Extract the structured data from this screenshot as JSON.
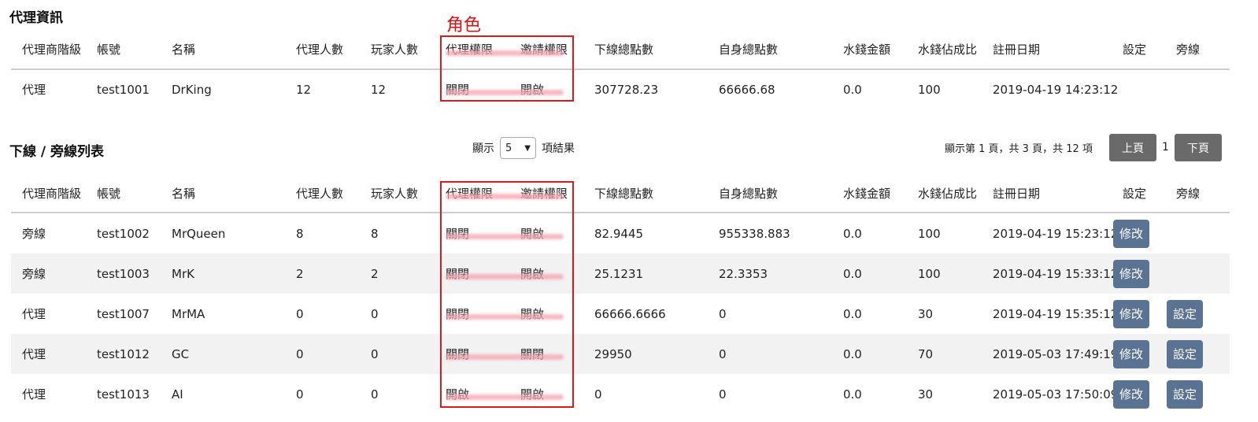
{
  "agent_section": {
    "title": "代理資訊",
    "headers": [
      "代理商階級",
      "帳號",
      "名稱",
      "代理人數",
      "玩家人數",
      "代理權限",
      "邀請權限",
      "下線總點數",
      "自身總點數",
      "水錢金額",
      "水錢佔成比",
      "註冊日期",
      "設定",
      "旁線"
    ],
    "row": {
      "level": "代理",
      "account": "test1001",
      "name": "DrKing",
      "agents": "12",
      "players": "12",
      "agent_perm": "關閉",
      "invite_perm": "開啟",
      "downline_points": "307728.23",
      "self_points": "66666.68",
      "water_amount": "0.0",
      "water_ratio": "100",
      "reg_date": "2019-04-19 14:23:12"
    }
  },
  "annotation": {
    "role_label": "角色"
  },
  "list_section": {
    "title": "下線 / 旁線列表",
    "show_label": "顯示",
    "page_size": "5",
    "results_label": "項結果",
    "page_info": "顯示第 1 頁，共 3 頁，共 12 項",
    "prev_label": "上頁",
    "current_page": "1",
    "next_label": "下頁",
    "headers": [
      "代理商階級",
      "帳號",
      "名稱",
      "代理人數",
      "玩家人數",
      "代理權限",
      "邀請權限",
      "下線總點數",
      "自身總點數",
      "水錢金額",
      "水錢佔成比",
      "註冊日期",
      "設定",
      "旁線"
    ],
    "edit_label": "修改",
    "setting_label": "設定",
    "rows": [
      {
        "level": "旁線",
        "account": "test1002",
        "name": "MrQueen",
        "agents": "8",
        "players": "8",
        "agent_perm": "關閉",
        "invite_perm": "開啟",
        "downline_points": "82.9445",
        "self_points": "955338.883",
        "water_amount": "0.0",
        "water_ratio": "100",
        "reg_date": "2019-04-19 15:23:12",
        "has_setting": false
      },
      {
        "level": "旁線",
        "account": "test1003",
        "name": "MrK",
        "agents": "2",
        "players": "2",
        "agent_perm": "關閉",
        "invite_perm": "開啟",
        "downline_points": "25.1231",
        "self_points": "22.3353",
        "water_amount": "0.0",
        "water_ratio": "100",
        "reg_date": "2019-04-19 15:33:12",
        "has_setting": false
      },
      {
        "level": "代理",
        "account": "test1007",
        "name": "MrMA",
        "agents": "0",
        "players": "0",
        "agent_perm": "關閉",
        "invite_perm": "開啟",
        "downline_points": "66666.6666",
        "self_points": "0",
        "water_amount": "0.0",
        "water_ratio": "30",
        "reg_date": "2019-04-19 15:35:12",
        "has_setting": true
      },
      {
        "level": "代理",
        "account": "test1012",
        "name": "GC",
        "agents": "0",
        "players": "0",
        "agent_perm": "關閉",
        "invite_perm": "關閉",
        "downline_points": "29950",
        "self_points": "0",
        "water_amount": "0.0",
        "water_ratio": "70",
        "reg_date": "2019-05-03 17:49:19",
        "has_setting": true
      },
      {
        "level": "代理",
        "account": "test1013",
        "name": "AI",
        "agents": "0",
        "players": "0",
        "agent_perm": "開啟",
        "invite_perm": "開啟",
        "downline_points": "0",
        "self_points": "0",
        "water_amount": "0.0",
        "water_ratio": "30",
        "reg_date": "2019-05-03 17:50:09",
        "has_setting": true
      }
    ]
  }
}
